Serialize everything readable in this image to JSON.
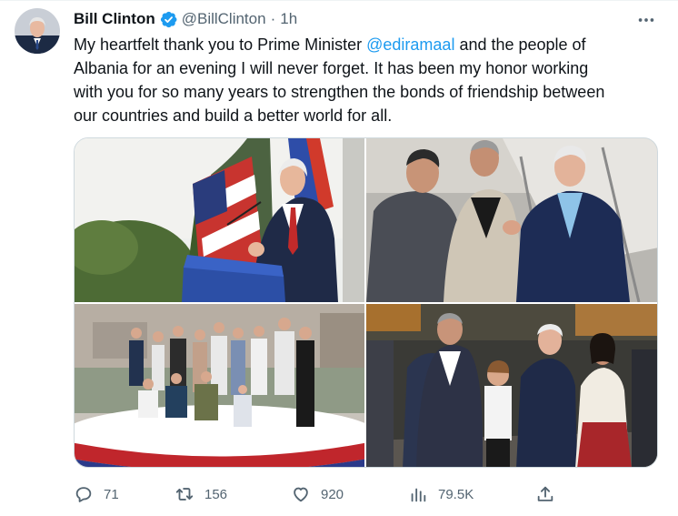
{
  "tweet": {
    "author": {
      "name": "Bill Clinton",
      "handle": "@BillClinton",
      "verified": true,
      "avatar_icon": "avatar"
    },
    "separator": "·",
    "time": "1h",
    "text": {
      "line1_before": "My heartfelt thank you to Prime Minister ",
      "mention": "@ediramaal",
      "line1_after": " and the people of",
      "line2": "Albania for an evening I will never forget. It has been my honor working",
      "line3": "with you for so many years to strengthen the bonds of friendship between",
      "line4": "our countries and build a better world for all."
    },
    "metrics": {
      "replies": "71",
      "retweets": "156",
      "likes": "920",
      "views": "79.5K"
    },
    "icons": [
      "more-icon",
      "reply-icon",
      "retweet-icon",
      "like-icon",
      "views-icon",
      "share-icon",
      "verified-badge-icon"
    ],
    "colors": {
      "accent": "#1d9bf0",
      "secondary_text": "#536471",
      "primary_text": "#0f1419",
      "border": "#cfd9de"
    }
  }
}
